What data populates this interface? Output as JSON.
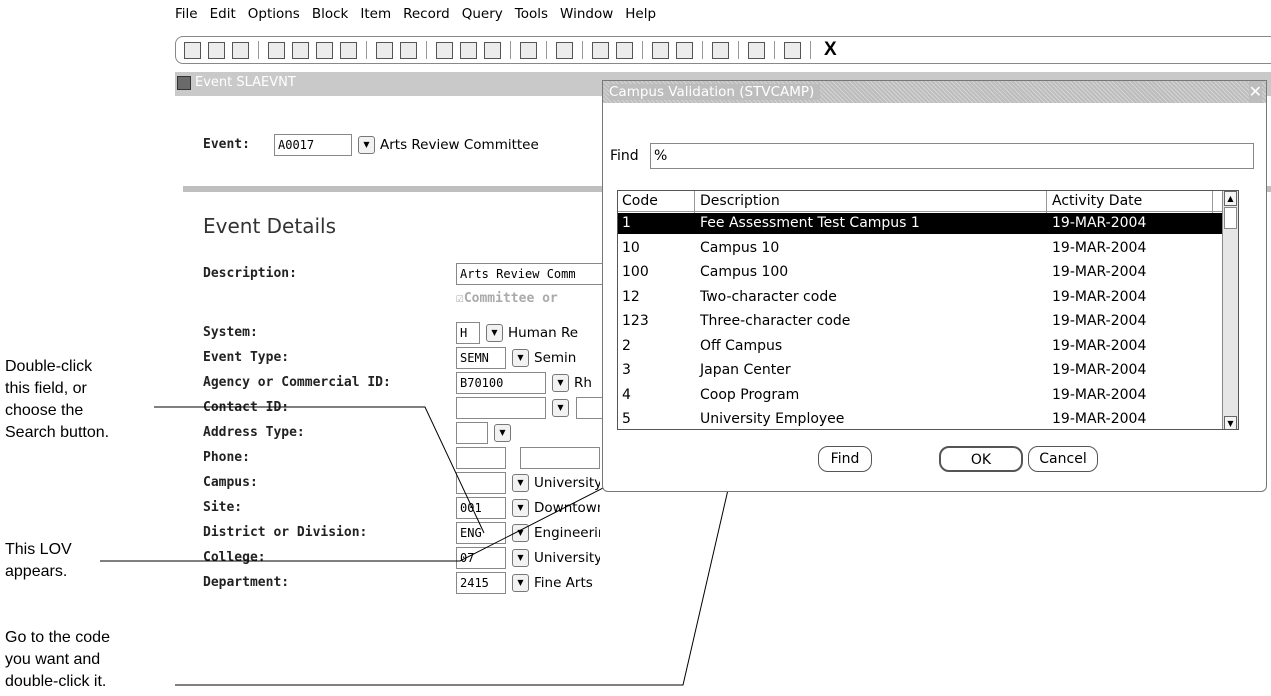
{
  "menu": [
    "File",
    "Edit",
    "Options",
    "Block",
    "Item",
    "Record",
    "Query",
    "Tools",
    "Window",
    "Help"
  ],
  "toolbar_icons": [
    "save-icon",
    "rollback-icon",
    "print-page-icon",
    "insert-record-icon",
    "remove-record-icon",
    "clear-block-icon",
    "clear-record-icon",
    "next-block-icon",
    "previous-block-icon",
    "options-icon",
    "database-icon",
    "delete-icon",
    "copy-icon",
    "print-icon",
    "export-icon",
    "excel-icon",
    "first-icon",
    "last-icon",
    "audio-icon",
    "target-icon",
    "help-icon",
    "exit-icon"
  ],
  "toolbar_exit": "X",
  "window": {
    "title": "Event  SLAEVNT"
  },
  "event": {
    "label": "Event:",
    "code": "A0017",
    "name": "Arts Review Committee"
  },
  "section_title": "Event Details",
  "fields": [
    {
      "label": "Description:",
      "value": "Arts Review Comm",
      "desc": ""
    },
    {
      "label": "",
      "value": "",
      "desc": ""
    },
    {
      "label": "System:",
      "value": "H",
      "desc": "Human Re"
    },
    {
      "label": "Event Type:",
      "value": "SEMN",
      "desc": "Semin"
    },
    {
      "label": "Agency or Commercial ID:",
      "value": "B70100",
      "desc": "Rh"
    },
    {
      "label": "Contact ID:",
      "value": "",
      "desc": ""
    },
    {
      "label": "Address Type:",
      "value": "",
      "desc": ""
    },
    {
      "label": "Phone:",
      "value": "",
      "desc": ""
    },
    {
      "label": "Campus:",
      "value": "",
      "desc": "University Employee"
    },
    {
      "label": "Site:",
      "value": "001",
      "desc": "Downtown Site"
    },
    {
      "label": "District or Division:",
      "value": "ENG",
      "desc": "Engineering Division"
    },
    {
      "label": "College:",
      "value": "07",
      "desc": "University of British Columbia"
    },
    {
      "label": "Department:",
      "value": "2415",
      "desc": "Fine Arts"
    }
  ],
  "committee_checkbox": "Committee or",
  "notes": {
    "note1": [
      "Double-click",
      "this field, or",
      "choose the",
      "Search button."
    ],
    "note2": [
      "This LOV",
      "appears."
    ],
    "note3": [
      "Go to the code",
      "you want and",
      "double-click it."
    ]
  },
  "dialog": {
    "title": "Campus Validation (STVCAMP)",
    "find_label": "Find",
    "find_value": "%",
    "columns": [
      "Code",
      "Description",
      "Activity Date"
    ],
    "rows": [
      [
        "1",
        "Fee Assessment Test Campus 1",
        "19-MAR-2004"
      ],
      [
        "10",
        "Campus 10",
        "19-MAR-2004"
      ],
      [
        "100",
        "Campus 100",
        "19-MAR-2004"
      ],
      [
        "12",
        "Two-character code",
        "19-MAR-2004"
      ],
      [
        "123",
        "Three-character code",
        "19-MAR-2004"
      ],
      [
        "2",
        "Off Campus",
        "19-MAR-2004"
      ],
      [
        "3",
        "Japan Center",
        "19-MAR-2004"
      ],
      [
        "4",
        "Coop Program",
        "19-MAR-2004"
      ],
      [
        "5",
        "University Employee",
        "19-MAR-2004"
      ]
    ],
    "selected_row": 0,
    "buttons": {
      "find": "Find",
      "ok": "OK",
      "cancel": "Cancel"
    }
  }
}
